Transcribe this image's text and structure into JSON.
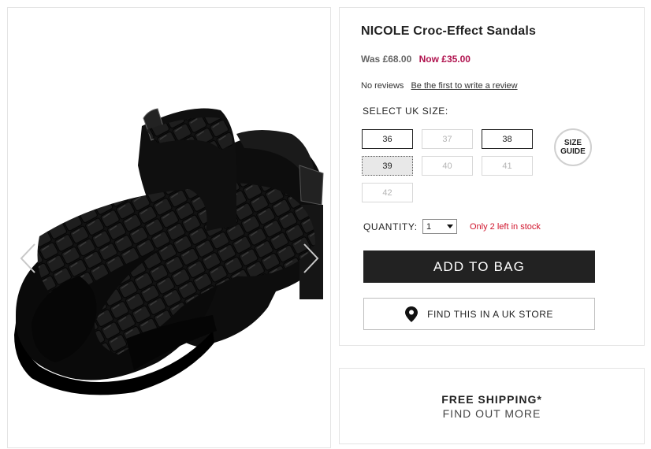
{
  "product": {
    "title": "NICOLE Croc-Effect Sandals",
    "price_was": "Was £68.00",
    "price_now": "Now £35.00"
  },
  "reviews": {
    "count_text": "No reviews",
    "link_text": "Be the first to write a review"
  },
  "size": {
    "label": "SELECT UK SIZE:",
    "options": [
      {
        "label": "36",
        "available": true
      },
      {
        "label": "37",
        "available": false
      },
      {
        "label": "38",
        "available": true
      },
      {
        "label": "39",
        "available": true,
        "selected": true
      },
      {
        "label": "40",
        "available": false
      },
      {
        "label": "41",
        "available": false
      },
      {
        "label": "42",
        "available": false
      }
    ],
    "guide_line1": "SIZE",
    "guide_line2": "GUIDE"
  },
  "quantity": {
    "label": "QUANTITY:",
    "value": "1",
    "stock_text": "Only 2 left in stock"
  },
  "actions": {
    "add_to_bag": "ADD TO BAG",
    "find_store": "FIND THIS IN A UK STORE"
  },
  "shipping": {
    "title": "FREE SHIPPING*",
    "subtitle": "FIND OUT MORE"
  },
  "colors": {
    "price_now": "#b0124e",
    "stock_warning": "#d0142c",
    "primary_button": "#222222"
  },
  "icons": {
    "gallery_prev": "chevron-left-icon",
    "gallery_next": "chevron-right-icon",
    "store": "map-pin-icon"
  }
}
